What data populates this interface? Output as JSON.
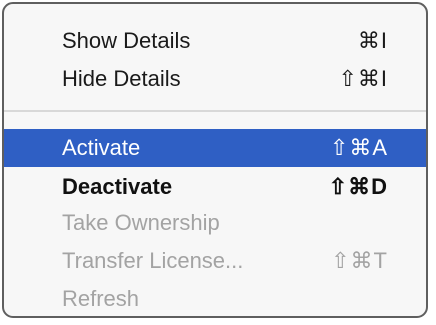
{
  "menu": {
    "items": [
      {
        "label": "Show Details",
        "shortcut": "⌘I"
      },
      {
        "label": "Hide Details",
        "shortcut": "⇧⌘I"
      },
      {
        "label": "Activate",
        "shortcut": "⇧⌘A",
        "state": "highlighted"
      },
      {
        "label": "Deactivate",
        "shortcut": "⇧⌘D",
        "state": "emphasized"
      },
      {
        "label": "Take Ownership",
        "shortcut": "",
        "state": "disabled"
      },
      {
        "label": "Transfer License...",
        "shortcut": "⇧⌘T",
        "state": "disabled"
      },
      {
        "label": "Refresh",
        "shortcut": "",
        "state": "disabled"
      }
    ]
  },
  "colors": {
    "highlight": "#2f5fc4",
    "disabled_text": "#a3a3a3",
    "menu_background": "#f7f7f7"
  }
}
